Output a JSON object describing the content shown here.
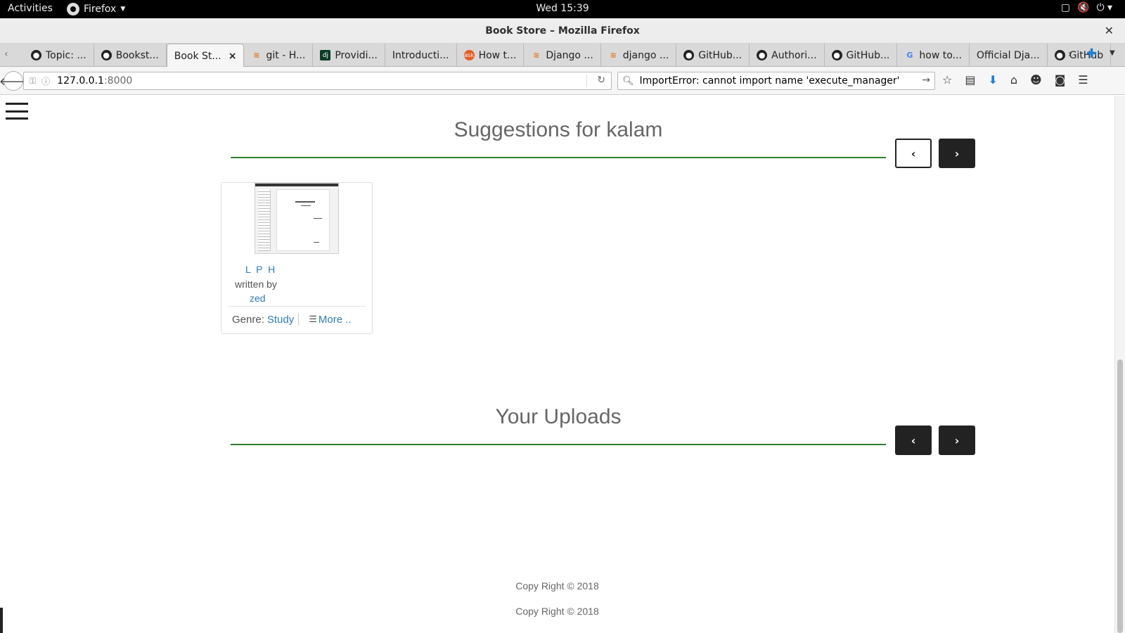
{
  "system_bar": {
    "activities": "Activities",
    "app_name": "Firefox",
    "clock": "Wed 15:39"
  },
  "window": {
    "title": "Book Store – Mozilla Firefox"
  },
  "tabs": [
    {
      "label": "Topic: ...",
      "favicon": "github"
    },
    {
      "label": "Bookst...",
      "favicon": "github"
    },
    {
      "label": "Book St...",
      "favicon": "none",
      "active": true
    },
    {
      "label": "git - H...",
      "favicon": "stackoverflow"
    },
    {
      "label": "Providi...",
      "favicon": "django"
    },
    {
      "label": "Introducti...",
      "favicon": "none"
    },
    {
      "label": "How t...",
      "favicon": "ask"
    },
    {
      "label": "Django ...",
      "favicon": "stackoverflow"
    },
    {
      "label": "django ...",
      "favicon": "stackoverflow"
    },
    {
      "label": "GitHub...",
      "favicon": "github"
    },
    {
      "label": "Authori...",
      "favicon": "github"
    },
    {
      "label": "GitHub...",
      "favicon": "github"
    },
    {
      "label": "how to...",
      "favicon": "google"
    },
    {
      "label": "Official Dja...",
      "favicon": "none"
    },
    {
      "label": "GitHub",
      "favicon": "github"
    }
  ],
  "navbar": {
    "url_host": "127.0.0.1",
    "url_port": ":8000",
    "search_query": "ImportError: cannot import name 'execute_manager'"
  },
  "page": {
    "suggestions_title": "Suggestions for kalam",
    "uploads_title": "Your Uploads",
    "prev_glyph": "‹",
    "next_glyph": "›",
    "book": {
      "title": "L P H",
      "written_by": "written by",
      "author": "zed",
      "genre_label": "Genre:",
      "genre": "Study",
      "more": "More .."
    },
    "footer_1": "Copy Right © 2018",
    "footer_2": "Copy Right © 2018"
  },
  "colors": {
    "accent_rule": "#2e7d32",
    "link": "#337ab7",
    "button_dark": "#222222"
  }
}
